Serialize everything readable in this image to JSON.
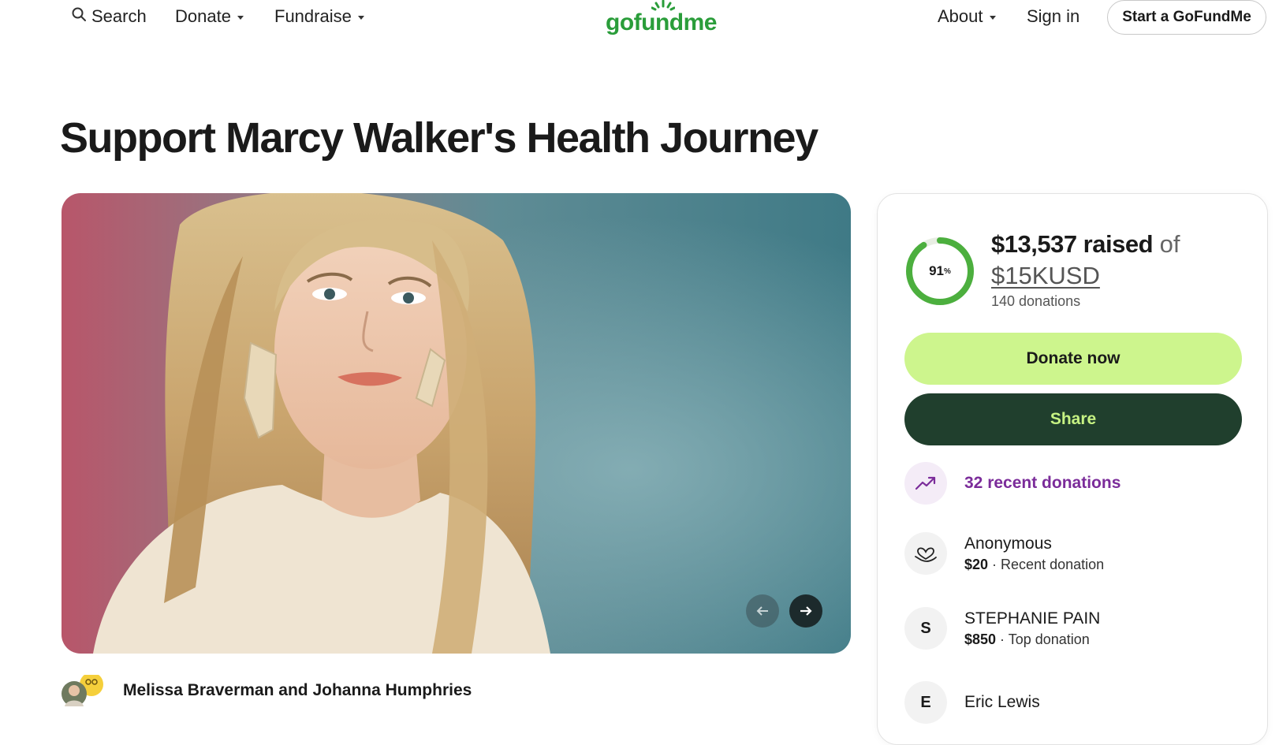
{
  "header": {
    "search_label": "Search",
    "donate_label": "Donate",
    "fundraise_label": "Fundraise",
    "logo_text": "gofundme",
    "about_label": "About",
    "signin_label": "Sign in",
    "start_label": "Start a GoFundMe",
    "brand_color": "#2a9d3a"
  },
  "page": {
    "title": "Support Marcy Walker's Health Journey"
  },
  "hero": {
    "prev_icon": "arrow-left-icon",
    "next_icon": "arrow-right-icon"
  },
  "organizer": {
    "names": "Melissa Braverman and Johanna Humphries"
  },
  "donation_card": {
    "progress_percent": 91,
    "progress_label": "91",
    "progress_sup": "%",
    "raised_amount": "$13,537 raised",
    "raised_of": "of",
    "goal": "$15KUSD",
    "donations_count": "140 donations",
    "donate_now_label": "Donate now",
    "share_label": "Share",
    "recent_donations_label": "32 recent donations",
    "accent_green": "#cdf58d",
    "dark_green": "#203f2d",
    "purple": "#7b2c9a",
    "donors": [
      {
        "initial": "",
        "name": "Anonymous",
        "amount": "$20",
        "note": "Recent donation"
      },
      {
        "initial": "S",
        "name": "STEPHANIE PAIN",
        "amount": "$850",
        "note": "Top donation"
      },
      {
        "initial": "E",
        "name": "Eric Lewis",
        "amount": "",
        "note": ""
      }
    ]
  }
}
